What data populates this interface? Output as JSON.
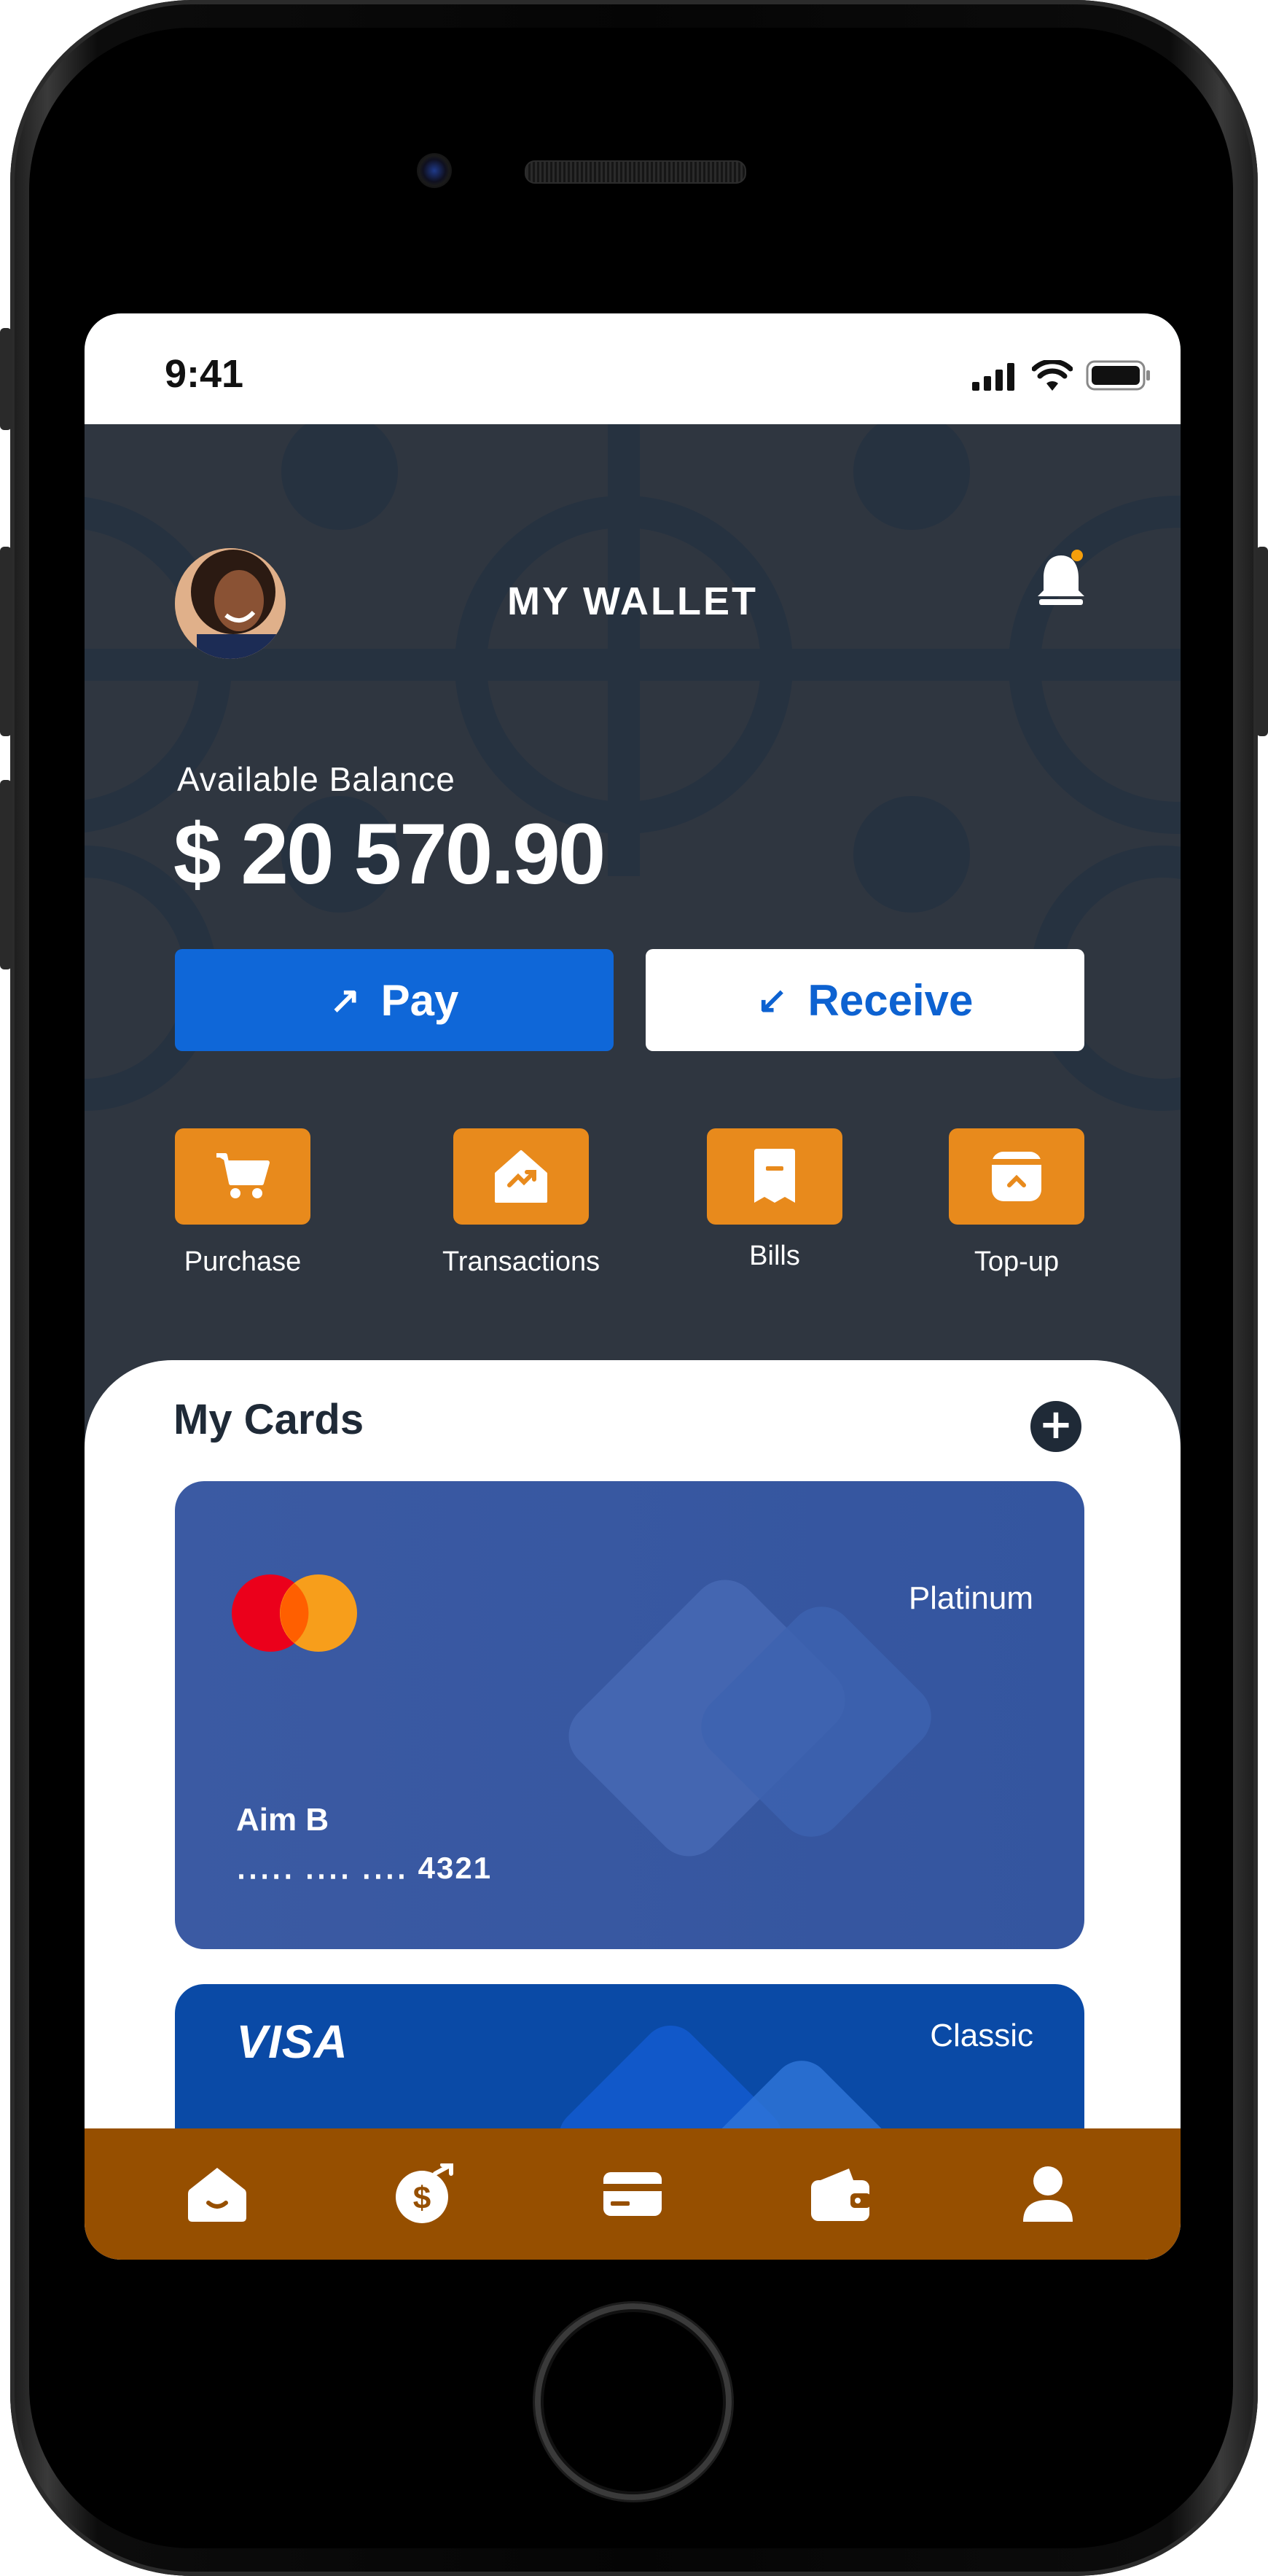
{
  "status_bar": {
    "time": "9:41"
  },
  "header": {
    "title": "MY WALLET"
  },
  "balance": {
    "label": "Available Balance",
    "amount": "$ 20 570.90"
  },
  "buttons": {
    "pay": "Pay",
    "receive": "Receive"
  },
  "actions": [
    {
      "label": "Purchase",
      "icon": "cart-icon"
    },
    {
      "label": "Transactions",
      "icon": "chart-up-icon"
    },
    {
      "label": "Bills",
      "icon": "receipt-icon"
    },
    {
      "label": "Top-up",
      "icon": "wallet-box-icon"
    }
  ],
  "cards_section": {
    "title": "My Cards",
    "cards": [
      {
        "network": "mastercard-logo",
        "tier": "Platinum",
        "holder": "Aim B",
        "number": "․․․․․   ․․․․ ․․․․   4321"
      },
      {
        "network": "VISA",
        "tier": "Classic"
      }
    ]
  },
  "bottom_nav": [
    {
      "icon": "home-icon"
    },
    {
      "icon": "money-transfer-icon"
    },
    {
      "icon": "credit-card-icon"
    },
    {
      "icon": "wallet-icon"
    },
    {
      "icon": "profile-icon"
    }
  ],
  "colors": {
    "primary_blue": "#0f67d8",
    "accent_orange": "#e88a1c",
    "nav_brown": "#964f00",
    "hero_dark": "#2f3640"
  }
}
